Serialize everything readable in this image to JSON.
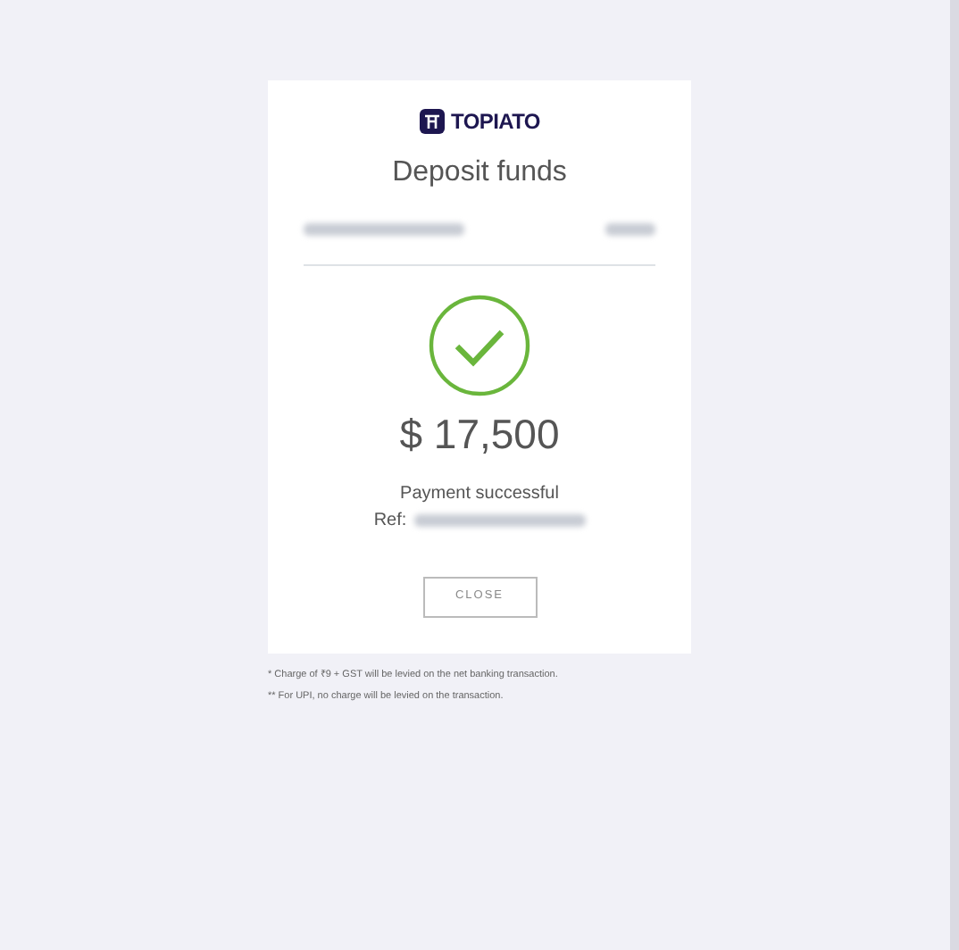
{
  "logo": {
    "text": "TOPIATO"
  },
  "title": "Deposit funds",
  "amount": "$ 17,500",
  "status": "Payment successful",
  "ref_label": "Ref:",
  "close_button": "CLOSE",
  "notes": [
    "* Charge of ₹9 + GST will be levied on the net banking transaction.",
    "** For UPI, no charge will be levied on the transaction."
  ]
}
